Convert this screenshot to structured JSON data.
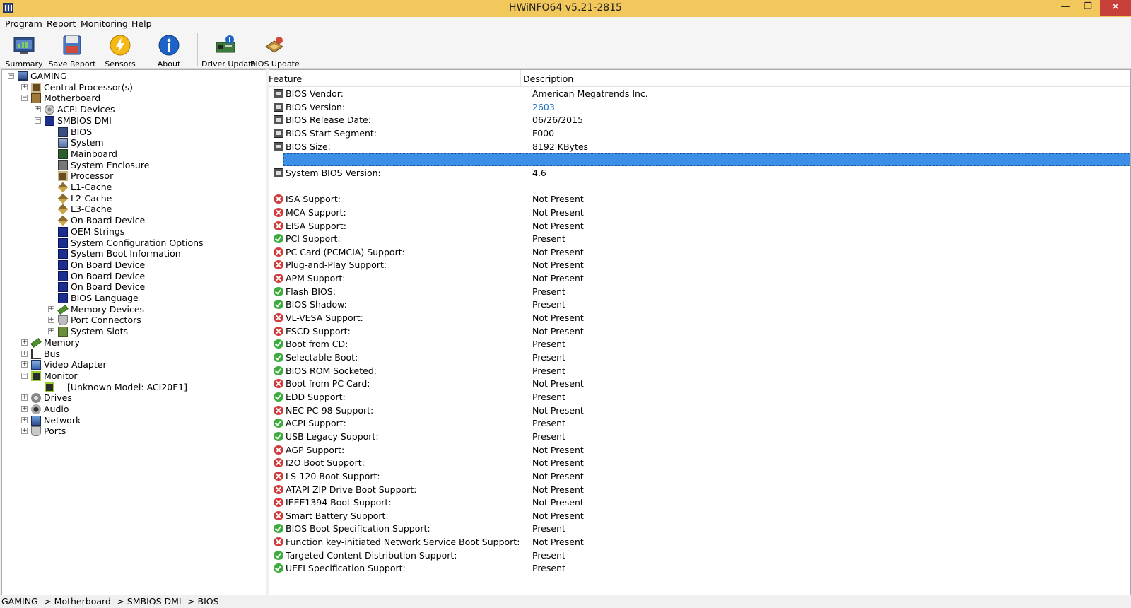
{
  "window": {
    "title": "HWiNFO64 v5.21-2815",
    "min": "—",
    "max": "❐",
    "close": "✕"
  },
  "menu": [
    "Program",
    "Report",
    "Monitoring",
    "Help"
  ],
  "toolbar": {
    "summary": "Summary",
    "save_report": "Save Report",
    "sensors": "Sensors",
    "about": "About",
    "driver_update": "Driver Update",
    "bios_update": "BIOS Update"
  },
  "tree": [
    {
      "label": "GAMING",
      "level": 0,
      "exp": "−",
      "icon": "pc"
    },
    {
      "label": "Central Processor(s)",
      "level": 1,
      "exp": "+",
      "icon": "cpu"
    },
    {
      "label": "Motherboard",
      "level": 1,
      "exp": "−",
      "icon": "mb"
    },
    {
      "label": "ACPI Devices",
      "level": 2,
      "exp": "+",
      "icon": "acpi"
    },
    {
      "label": "SMBIOS DMI",
      "level": 2,
      "exp": "−",
      "icon": "dmi"
    },
    {
      "label": "BIOS",
      "level": 3,
      "icon": "chip"
    },
    {
      "label": "System",
      "level": 3,
      "icon": "sys"
    },
    {
      "label": "Mainboard",
      "level": 3,
      "icon": "board"
    },
    {
      "label": "System Enclosure",
      "level": 3,
      "icon": "encl"
    },
    {
      "label": "Processor",
      "level": 3,
      "icon": "cpu"
    },
    {
      "label": "L1-Cache",
      "level": 3,
      "icon": "cache"
    },
    {
      "label": "L2-Cache",
      "level": 3,
      "icon": "cache"
    },
    {
      "label": "L3-Cache",
      "level": 3,
      "icon": "cache"
    },
    {
      "label": "On Board Device",
      "level": 3,
      "icon": "cache"
    },
    {
      "label": "OEM Strings",
      "level": 3,
      "icon": "dmi"
    },
    {
      "label": "System Configuration Options",
      "level": 3,
      "icon": "dmi"
    },
    {
      "label": "System Boot Information",
      "level": 3,
      "icon": "dmi"
    },
    {
      "label": "On Board Device",
      "level": 3,
      "icon": "dmi"
    },
    {
      "label": "On Board Device",
      "level": 3,
      "icon": "dmi"
    },
    {
      "label": "On Board Device",
      "level": 3,
      "icon": "dmi"
    },
    {
      "label": "BIOS Language",
      "level": 3,
      "icon": "dmi"
    },
    {
      "label": "Memory Devices",
      "level": 3,
      "exp": "+",
      "icon": "mem"
    },
    {
      "label": "Port Connectors",
      "level": 3,
      "exp": "+",
      "icon": "port"
    },
    {
      "label": "System Slots",
      "level": 3,
      "exp": "+",
      "icon": "slot"
    },
    {
      "label": "Memory",
      "level": 1,
      "exp": "+",
      "icon": "mem"
    },
    {
      "label": "Bus",
      "level": 1,
      "exp": "+",
      "icon": "bus"
    },
    {
      "label": "Video Adapter",
      "level": 1,
      "exp": "+",
      "icon": "video"
    },
    {
      "label": "Monitor",
      "level": 1,
      "exp": "−",
      "icon": "monitor"
    },
    {
      "label": "[Unknown Model: ACI20E1]",
      "level": 2,
      "icon": "monitor"
    },
    {
      "label": "Drives",
      "level": 1,
      "exp": "+",
      "icon": "drive"
    },
    {
      "label": "Audio",
      "level": 1,
      "exp": "+",
      "icon": "audio"
    },
    {
      "label": "Network",
      "level": 1,
      "exp": "+",
      "icon": "net"
    },
    {
      "label": "Ports",
      "level": 1,
      "exp": "+",
      "icon": "ports"
    }
  ],
  "list": {
    "headers": {
      "feature": "Feature",
      "description": "Description"
    },
    "rows": [
      {
        "feature": "BIOS Vendor:",
        "value": "American Megatrends Inc.",
        "icon": "bios"
      },
      {
        "feature": "BIOS Version:",
        "value": "2603",
        "icon": "bios",
        "link": true
      },
      {
        "feature": "BIOS Release Date:",
        "value": "06/26/2015",
        "icon": "bios"
      },
      {
        "feature": "BIOS Start Segment:",
        "value": "F000",
        "icon": "bios"
      },
      {
        "feature": "BIOS Size:",
        "value": "8192 KBytes",
        "icon": "bios"
      },
      {
        "feature": "",
        "value": "",
        "icon": "",
        "selected": true
      },
      {
        "feature": "System BIOS Version:",
        "value": "4.6",
        "icon": "bios"
      },
      {
        "feature": "",
        "value": "",
        "icon": ""
      },
      {
        "feature": "ISA Support:",
        "value": "Not Present",
        "icon": "no"
      },
      {
        "feature": "MCA Support:",
        "value": "Not Present",
        "icon": "no"
      },
      {
        "feature": "EISA Support:",
        "value": "Not Present",
        "icon": "no"
      },
      {
        "feature": "PCI Support:",
        "value": "Present",
        "icon": "ok"
      },
      {
        "feature": "PC Card (PCMCIA) Support:",
        "value": "Not Present",
        "icon": "no"
      },
      {
        "feature": "Plug-and-Play Support:",
        "value": "Not Present",
        "icon": "no"
      },
      {
        "feature": "APM Support:",
        "value": "Not Present",
        "icon": "no"
      },
      {
        "feature": "Flash BIOS:",
        "value": "Present",
        "icon": "ok"
      },
      {
        "feature": "BIOS Shadow:",
        "value": "Present",
        "icon": "ok"
      },
      {
        "feature": "VL-VESA Support:",
        "value": "Not Present",
        "icon": "no"
      },
      {
        "feature": "ESCD Support:",
        "value": "Not Present",
        "icon": "no"
      },
      {
        "feature": "Boot from CD:",
        "value": "Present",
        "icon": "ok"
      },
      {
        "feature": "Selectable Boot:",
        "value": "Present",
        "icon": "ok"
      },
      {
        "feature": "BIOS ROM Socketed:",
        "value": "Present",
        "icon": "ok"
      },
      {
        "feature": "Boot from PC Card:",
        "value": "Not Present",
        "icon": "no"
      },
      {
        "feature": "EDD Support:",
        "value": "Present",
        "icon": "ok"
      },
      {
        "feature": "NEC PC-98 Support:",
        "value": "Not Present",
        "icon": "no"
      },
      {
        "feature": "ACPI Support:",
        "value": "Present",
        "icon": "ok"
      },
      {
        "feature": "USB Legacy Support:",
        "value": "Present",
        "icon": "ok"
      },
      {
        "feature": "AGP Support:",
        "value": "Not Present",
        "icon": "no"
      },
      {
        "feature": "I2O Boot Support:",
        "value": "Not Present",
        "icon": "no"
      },
      {
        "feature": "LS-120 Boot Support:",
        "value": "Not Present",
        "icon": "no"
      },
      {
        "feature": "ATAPI ZIP Drive Boot Support:",
        "value": "Not Present",
        "icon": "no"
      },
      {
        "feature": "IEEE1394 Boot Support:",
        "value": "Not Present",
        "icon": "no"
      },
      {
        "feature": "Smart Battery Support:",
        "value": "Not Present",
        "icon": "no"
      },
      {
        "feature": "BIOS Boot Specification Support:",
        "value": "Present",
        "icon": "ok"
      },
      {
        "feature": "Function key-initiated Network Service Boot Support:",
        "value": "Not Present",
        "icon": "no"
      },
      {
        "feature": "Targeted Content Distribution Support:",
        "value": "Present",
        "icon": "ok"
      },
      {
        "feature": "UEFI Specification Support:",
        "value": "Present",
        "icon": "ok"
      }
    ]
  },
  "status": {
    "path": "GAMING -> Motherboard -> SMBIOS DMI -> BIOS"
  },
  "colors": {
    "titlebar": "#f2c75c",
    "selection": "#3c8fe6",
    "link": "#1f6fc2",
    "close": "#c7403a"
  }
}
